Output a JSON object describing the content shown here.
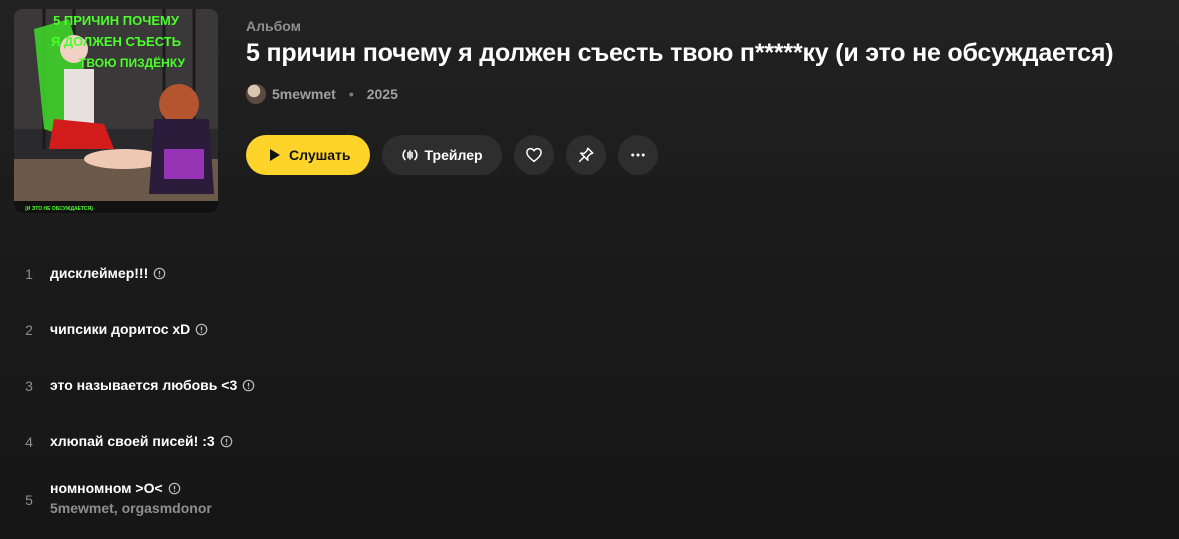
{
  "header": {
    "type_label": "Альбом",
    "title": "5 причин почему я должен съесть твою п*****ку (и это не обсуждается)",
    "artist": "5mewmet",
    "year": "2025",
    "separator": "•"
  },
  "cover": {
    "lines": [
      "5 ПРИЧИН ПОЧЕМУ",
      "Я ДОЛЖЕН СЪЕСТЬ",
      "ТВОЮ ПИЗДЁНКУ"
    ],
    "caption": "(И ЭТО НЕ ОБСУЖДАЕТСЯ)"
  },
  "actions": {
    "play_label": "Слушать",
    "trailer_label": "Трейлер",
    "like_icon": "heart-icon",
    "pin_icon": "pin-icon",
    "more_icon": "more-dots-icon"
  },
  "colors": {
    "accent": "#fed42b",
    "background": "#1b1b1b",
    "button_bg": "#2e2e2e",
    "muted_text": "#8e8e8e"
  },
  "tracks": [
    {
      "number": "1",
      "title": "дисклеймер!!!"
    },
    {
      "number": "2",
      "title": "чипсики доритос xD"
    },
    {
      "number": "3",
      "title": "это называется любовь <3"
    },
    {
      "number": "4",
      "title": "хлюпай своей писей! :3"
    },
    {
      "number": "5",
      "title": "номномном >O<",
      "artists": "5mewmet, orgasmdonor"
    }
  ]
}
